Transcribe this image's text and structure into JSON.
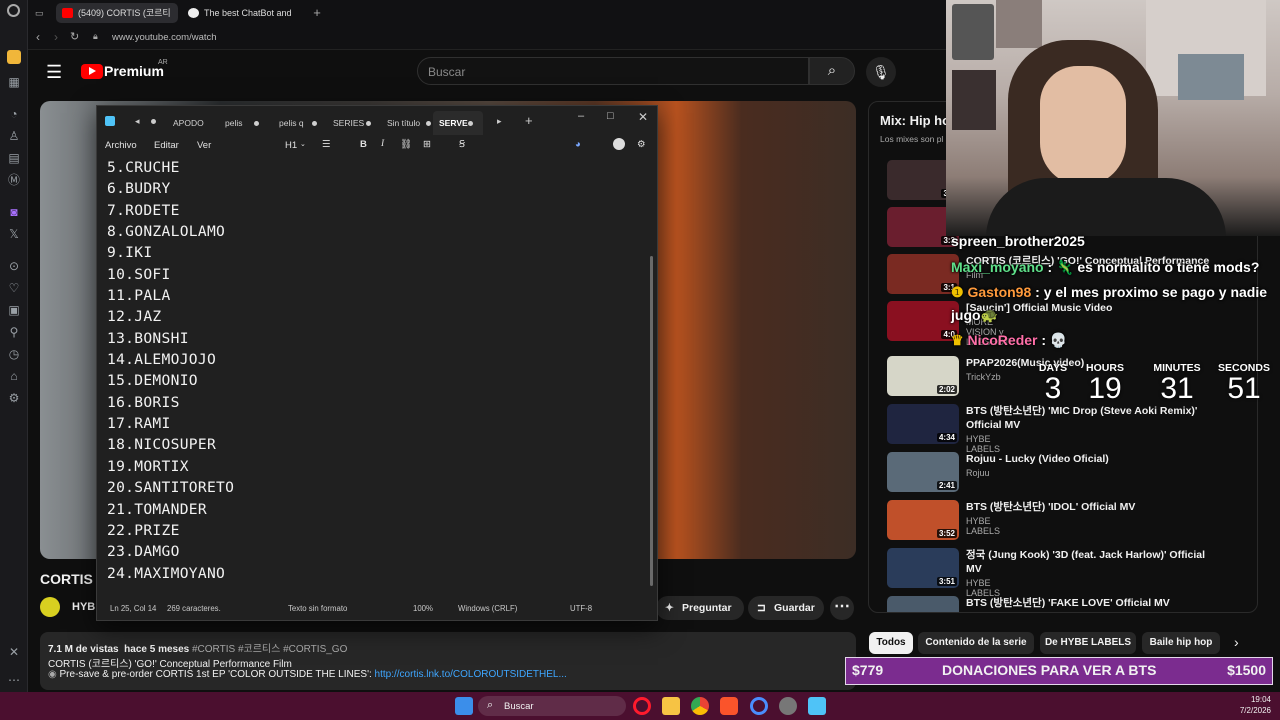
{
  "browser": {
    "tabs": [
      {
        "label": "(5409) CORTIS (코르티"
      },
      {
        "label": "The best ChatBot and"
      }
    ],
    "url": "www.youtube.com/watch"
  },
  "youtube": {
    "logo_label": "Premium",
    "logo_region": "AR",
    "search_placeholder": "Buscar",
    "video_title": "CORTIS",
    "channel_short": "HYB",
    "ask_label": "Preguntar",
    "save_label": "Guardar",
    "views": "7.1 M de vistas",
    "ago": "hace 5 meses",
    "tags": "#CORTIS #코르티스 #CORTIS_GO",
    "desc_line1": "CORTIS (코르티스) 'GO!' Conceptual Performance Film",
    "desc_line2_prefix": "Pre-save & pre-order CORTIS 1st EP 'COLOR OUTSIDE THE LINES':",
    "desc_link": "http://cortis.lnk.to/COLOROUTSIDETHEL...",
    "playlist": {
      "title": "Mix: Hip ho",
      "subtitle": "Los mixes son pl",
      "items": [
        {
          "title": "",
          "channel": "",
          "dur": "3:2",
          "color": "#3a2a2c"
        },
        {
          "title": "",
          "channel": "",
          "dur": "3:3",
          "color": "#6a1e2e"
        },
        {
          "title": "CORTIS (코르티스) 'GO!' Conceptual Performance",
          "channel": "Film",
          "dur": "3:1",
          "color": "#7a2a22"
        },
        {
          "title": "[Saucin'] Official Music Video",
          "channel": "MORE VISION y LNGSHOT",
          "dur": "4:0",
          "color": "#8a1020"
        },
        {
          "title": "PPAP2026(Music video)",
          "channel": "TrickYzb",
          "dur": "2:02",
          "color": "#d6d6c8"
        },
        {
          "title": "BTS (방탄소년단) 'MIC Drop (Steve Aoki Remix)' Official MV",
          "channel": "HYBE LABELS",
          "dur": "4:34",
          "color": "#1f2540"
        },
        {
          "title": "Rojuu - Lucky (Video Oficial)",
          "channel": "Rojuu",
          "dur": "2:41",
          "color": "#5a6a78"
        },
        {
          "title": "BTS (방탄소년단) 'IDOL' Official MV",
          "channel": "HYBE LABELS",
          "dur": "3:52",
          "color": "#c0502a"
        },
        {
          "title": "정국 (Jung Kook) '3D (feat. Jack Harlow)' Official MV",
          "channel": "HYBE LABELS",
          "dur": "3:51",
          "color": "#2a3c5a"
        },
        {
          "title": "BTS (방탄소년단) 'FAKE LOVE' Official MV",
          "channel": "",
          "dur": "",
          "color": "#4a5a6a"
        }
      ]
    },
    "chips": [
      "Todos",
      "Contenido de la serie",
      "De HYBE LABELS",
      "Baile hip hop"
    ]
  },
  "notepad": {
    "tabs": [
      "APODO",
      "pelis",
      "pelis q",
      "SERIES",
      "Sin título",
      "SERVE"
    ],
    "menu": [
      "Archivo",
      "Editar",
      "Ver"
    ],
    "heading": "H1",
    "lines": [
      "5.CRUCHE",
      "6.BUDRY",
      "7.RODETE",
      "8.GONZALOLAMO",
      "9.IKI",
      "10.SOFI",
      "11.PALA",
      "12.JAZ",
      "13.BONSHI",
      "14.ALEMOJOJO",
      "15.DEMONIO",
      "16.BORIS",
      "17.RAMI",
      "18.NICOSUPER",
      "19.MORTIX",
      "20.SANTITORETO",
      "21.TOMANDER",
      "22.PRIZE",
      "23.DAMGO",
      "24.MAXIMOYANO"
    ],
    "status": {
      "pos": "Ln 25, Col 14",
      "chars": "269 caracteres.",
      "format": "Texto sin formato",
      "zoom": "100%",
      "eol": "Windows (CRLF)",
      "enc": "UTF-8"
    }
  },
  "stream": {
    "chat": [
      {
        "user": "spreen_brother2025",
        "msg": "",
        "color": "#ffffff"
      },
      {
        "user": "Maxi_moyano",
        "msg": ": 🦎 es normalito o tiene mods?",
        "color": "#5fe08a"
      },
      {
        "user": "Gaston98",
        "msg": ": y el mes proximo se pago y nadie",
        "color": "#ff9a3c"
      },
      {
        "user": "",
        "msg": "jugo🐢",
        "color": "#ffffff"
      },
      {
        "user": "NicoReder",
        "msg": ": 💀",
        "color": "#ff6fa8"
      }
    ],
    "countdown": {
      "labels": [
        "DAYS",
        "HOURS",
        "MINUTES",
        "SECONDS"
      ],
      "values": [
        "3",
        "19",
        "31",
        "51"
      ]
    },
    "donation": {
      "left": "$779",
      "title": "DONACIONES PARA VER A BTS",
      "right": "$1500"
    }
  },
  "taskbar": {
    "search": "Buscar",
    "time": "19:04",
    "date": "7/2/2026"
  }
}
